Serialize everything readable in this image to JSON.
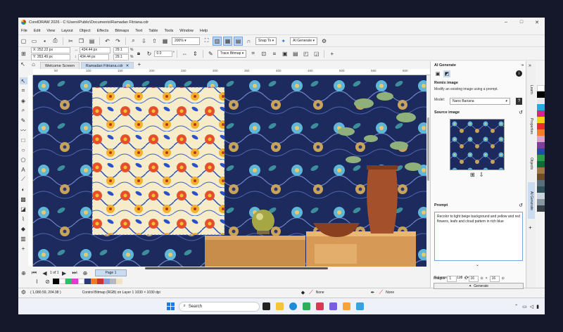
{
  "window": {
    "title": "CorelDRAW 2026 - C:\\Users\\Public\\Documents\\Ramadan Fitriana.cdr",
    "controls": [
      "–",
      "□",
      "✕"
    ]
  },
  "menu": [
    "File",
    "Edit",
    "View",
    "Layout",
    "Object",
    "Effects",
    "Bitmaps",
    "Text",
    "Table",
    "Tools",
    "Window",
    "Help"
  ],
  "toolbar": {
    "zoom": "200%",
    "snap_to": "Snap To",
    "ai_generate": "AI Generate"
  },
  "propbar": {
    "x": "X: 252.22 px",
    "y": "Y: 353.49 px",
    "w": "434.44 px",
    "h": "434.44 px",
    "scale_x": "29.1",
    "scale_y": "29.1",
    "rotation": "0.0",
    "trace_bitmap": "Trace Bitmap"
  },
  "doc_tabs": [
    {
      "label": "Welcome Screen",
      "active": false
    },
    {
      "label": "Ramadan Fitriana.cdr",
      "active": true
    }
  ],
  "ruler_ticks": [
    "50",
    "100",
    "150",
    "200",
    "250",
    "300",
    "350",
    "400",
    "450",
    "500",
    "550",
    "600"
  ],
  "pagebar": {
    "page_of": "1  of  1",
    "page_tab": "Page 1"
  },
  "status": {
    "coords": "( 1,080.59, 204.98 )",
    "object_info": "Control Bitmap (RGB) on Layer 1  1030 × 1030 dpi",
    "fill_none": "None",
    "outline_none": "None"
  },
  "ai_panel": {
    "title": "AI Generate",
    "remix_heading": "Remix image",
    "remix_desc": "Modify an existing image using a prompt.",
    "model_label": "Model:",
    "model_value": "Nano Banana",
    "source_heading": "Source image",
    "prompt_heading": "Prompt",
    "prompt_text": "Recolor to light beige background and yellow and red flowers, leafs and cloud pattern in rich blue",
    "balance_label": "Balance:",
    "balance_value": "4118",
    "images_label": "Images",
    "images_value": "1",
    "width_value": "16",
    "height_value": "16",
    "generate_label": "Generate"
  },
  "side_tabs": [
    "Learn",
    "Properties",
    "Objects",
    "AI Generate"
  ],
  "taskbar": {
    "search_placeholder": "Search"
  },
  "colors": {
    "canvas_bg": "#1b2452",
    "accent": "#3b78d8",
    "selection": "#c9dcf2"
  }
}
